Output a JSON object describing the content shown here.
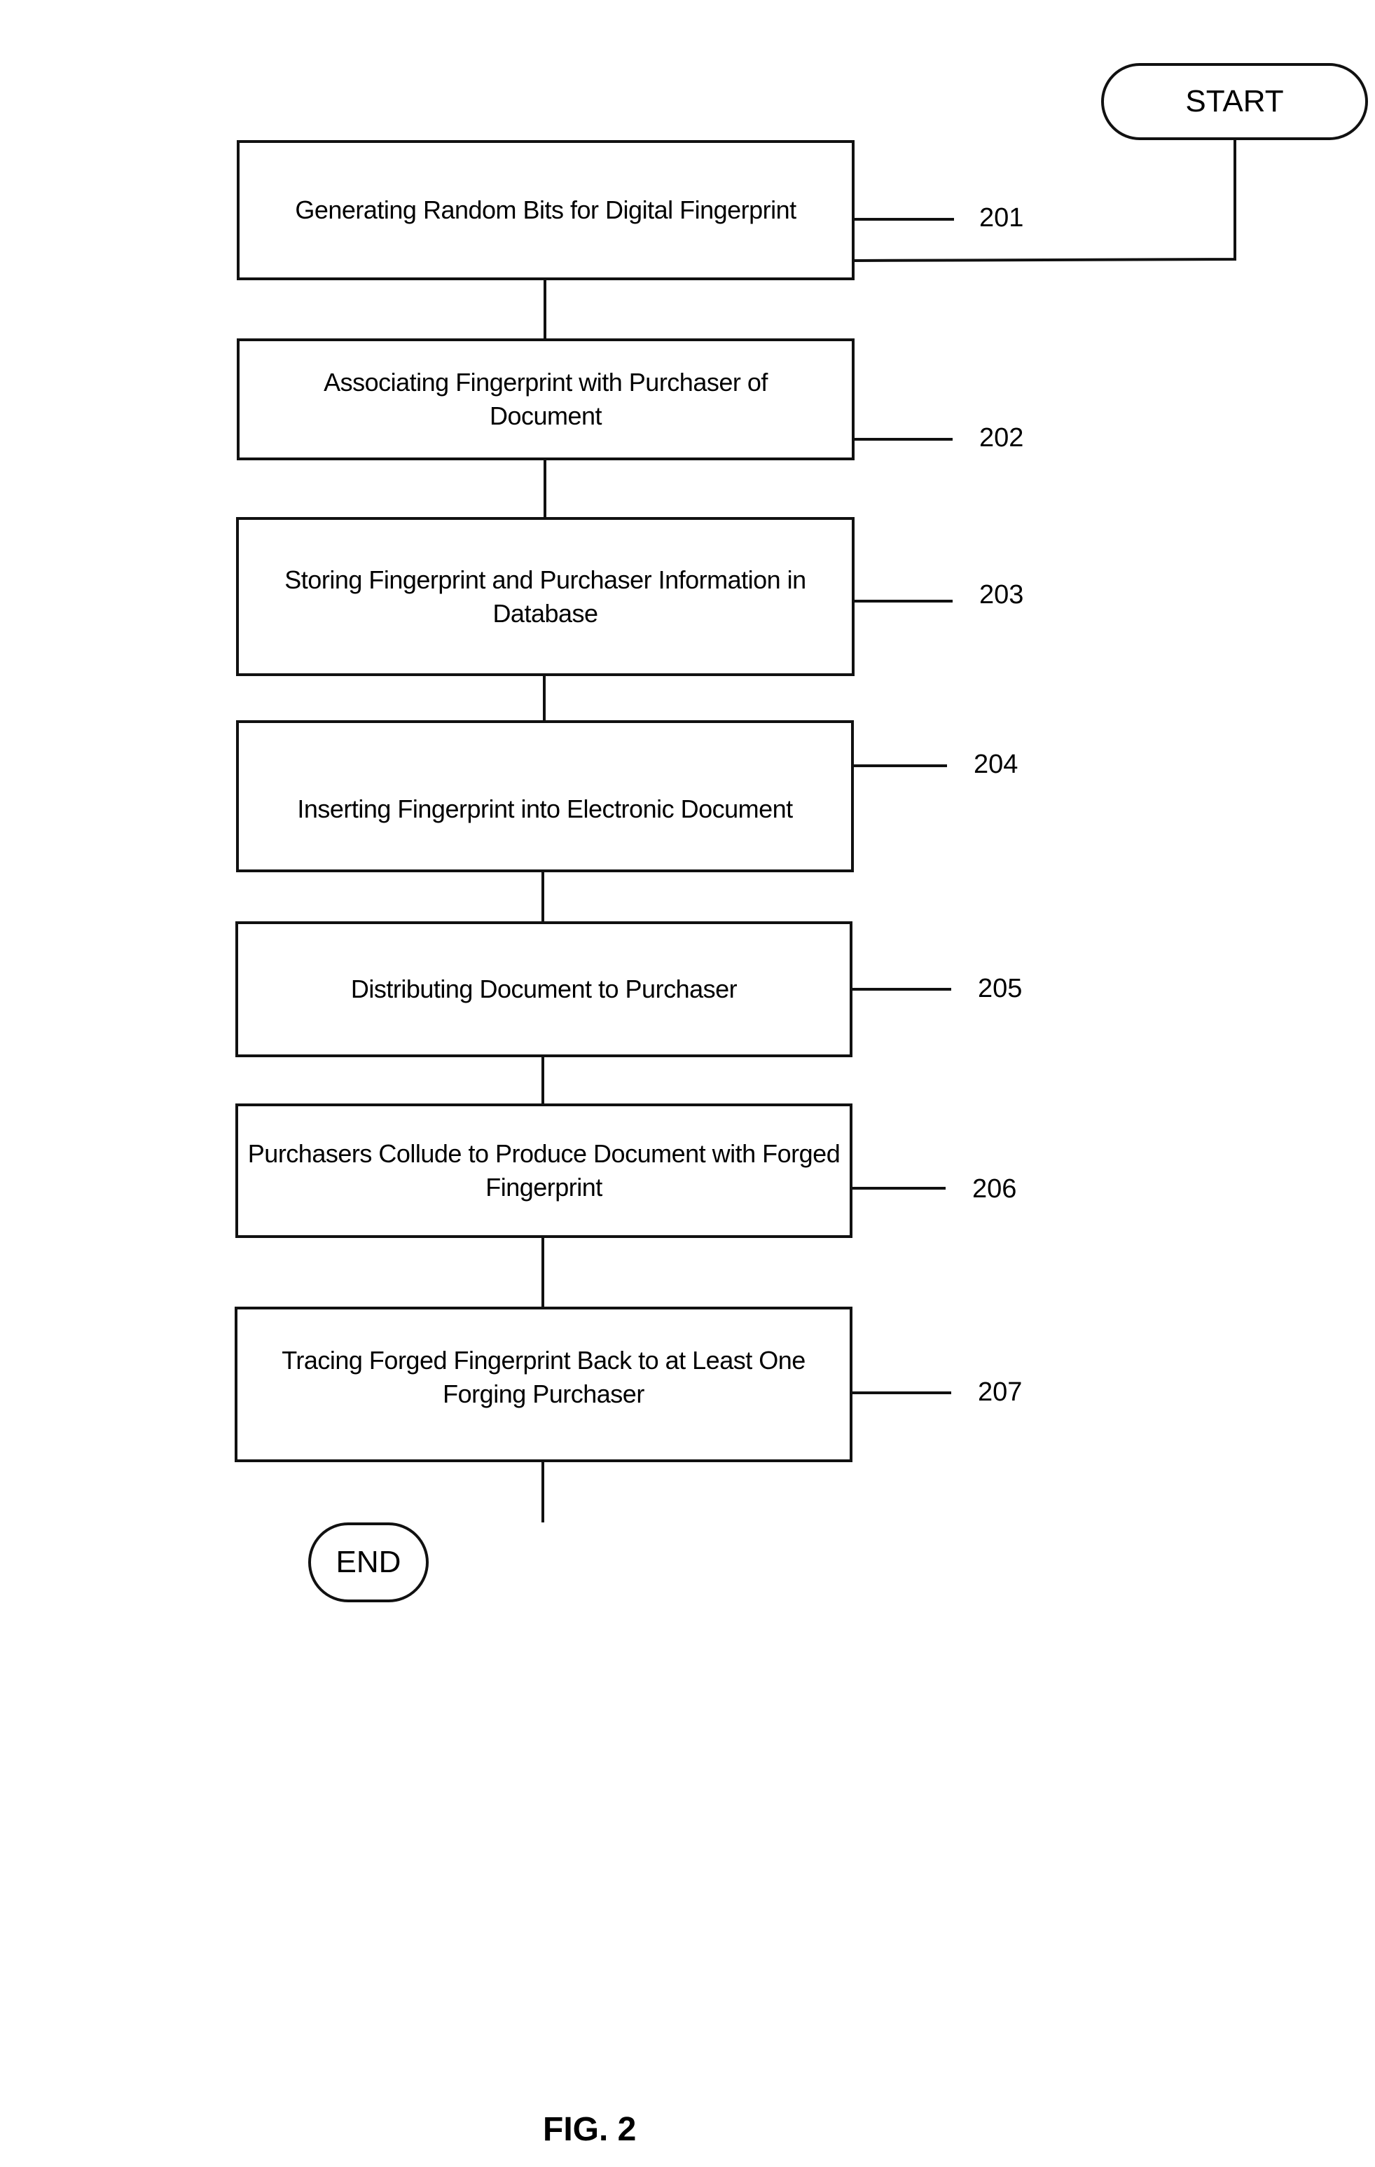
{
  "figure": {
    "caption": "FIG. 2",
    "start_label": "START",
    "end_label": "END",
    "steps": [
      {
        "ref": "201",
        "text": "Generating Random Bits for Digital Fingerprint"
      },
      {
        "ref": "202",
        "text": "Associating Fingerprint with Purchaser of Document"
      },
      {
        "ref": "203",
        "text": "Storing Fingerprint and Purchaser Information in Database"
      },
      {
        "ref": "204",
        "text": "Inserting Fingerprint into Electronic Document"
      },
      {
        "ref": "205",
        "text": "Distributing Document to Purchaser"
      },
      {
        "ref": "206",
        "text": "Purchasers Collude to Produce Document with Forged Fingerprint"
      },
      {
        "ref": "207",
        "text": "Tracing Forged Fingerprint Back to at Least One Forging Purchaser"
      }
    ]
  }
}
